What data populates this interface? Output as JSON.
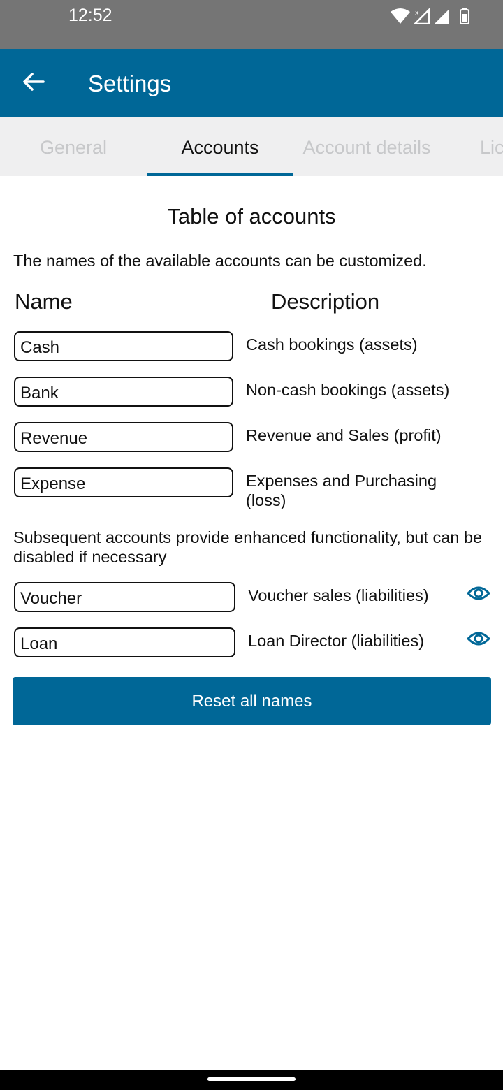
{
  "status_bar": {
    "time": "12:52",
    "icons": [
      "wifi-icon",
      "signal-icon",
      "signal-icon",
      "battery-icon"
    ]
  },
  "app_bar": {
    "back_icon": "arrow-left-icon",
    "title": "Settings",
    "background": "#006797"
  },
  "tabs": [
    {
      "label": "General",
      "active": false
    },
    {
      "label": "Accounts",
      "active": true
    },
    {
      "label": "Account details",
      "active": false
    },
    {
      "label": "Lic",
      "active": false
    }
  ],
  "content": {
    "title": "Table of accounts",
    "intro": "The names of the available accounts can be customized.",
    "headers": {
      "name": "Name",
      "description": "Description"
    },
    "accounts": [
      {
        "name": "Cash",
        "description": "Cash bookings (assets)"
      },
      {
        "name": "Bank",
        "description": "Non-cash bookings (assets)"
      },
      {
        "name": "Revenue",
        "description": "Revenue and Sales (profit)"
      },
      {
        "name": "Expense",
        "description": "Expenses and Purchasing (loss)"
      }
    ],
    "note": "Subsequent accounts provide enhanced functionality, but can be disabled if necessary",
    "optional_accounts": [
      {
        "name": "Voucher",
        "description": "Voucher sales (liabilities)",
        "icon": "eye-icon"
      },
      {
        "name": "Loan",
        "description": "Loan Director (liabilities)",
        "icon": "eye-icon"
      }
    ],
    "reset_label": "Reset all names"
  },
  "colors": {
    "accent": "#006797",
    "status_bar": "#757575",
    "tab_bar": "#efeff0",
    "tab_inactive_text": "#c7c8ca"
  }
}
